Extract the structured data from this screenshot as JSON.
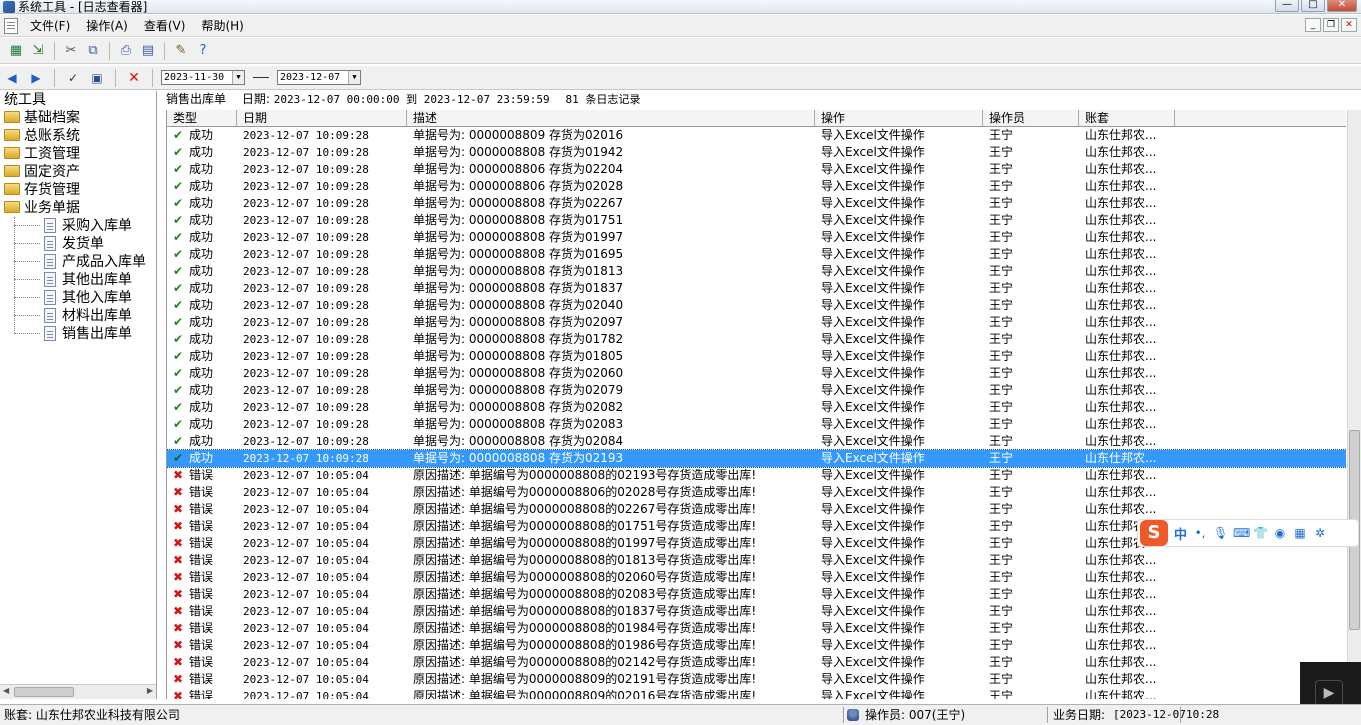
{
  "window": {
    "title": "系统工具 - [日志查看器]"
  },
  "menu": [
    "文件(F)",
    "操作(A)",
    "查看(V)",
    "帮助(H)"
  ],
  "filter": {
    "start_date": "2023-11-30",
    "end_date": "2023-12-07"
  },
  "tree": {
    "root": "统工具",
    "folders": [
      "基础档案",
      "总账系统",
      "工资管理",
      "固定资产",
      "存货管理",
      "业务单据"
    ],
    "children": [
      "采购入库单",
      "发货单",
      "产成品入库单",
      "其他出库单",
      "其他入库单",
      "材料出库单",
      "销售出库单"
    ]
  },
  "summary": {
    "doc_type": "销售出库单",
    "date_label": "日期:",
    "range": "2023-12-07 00:00:00 到 2023-12-07 23:59:59",
    "count": "81 条日志记录"
  },
  "columns": [
    "类型",
    "日期",
    "描述",
    "操作",
    "操作员",
    "账套"
  ],
  "selected_row_index": 19,
  "rows": [
    {
      "type": "成功",
      "status": "ok",
      "date": "2023-12-07 10:09:28",
      "desc": "单据号为:  0000008809 存货为02016",
      "op": "导入Excel文件操作",
      "user": "王宁",
      "acct": "山东仕邦农..."
    },
    {
      "type": "成功",
      "status": "ok",
      "date": "2023-12-07 10:09:28",
      "desc": "单据号为:  0000008808 存货为01942",
      "op": "导入Excel文件操作",
      "user": "王宁",
      "acct": "山东仕邦农..."
    },
    {
      "type": "成功",
      "status": "ok",
      "date": "2023-12-07 10:09:28",
      "desc": "单据号为:  0000008806 存货为02204",
      "op": "导入Excel文件操作",
      "user": "王宁",
      "acct": "山东仕邦农..."
    },
    {
      "type": "成功",
      "status": "ok",
      "date": "2023-12-07 10:09:28",
      "desc": "单据号为:  0000008806 存货为02028",
      "op": "导入Excel文件操作",
      "user": "王宁",
      "acct": "山东仕邦农..."
    },
    {
      "type": "成功",
      "status": "ok",
      "date": "2023-12-07 10:09:28",
      "desc": "单据号为:  0000008808 存货为02267",
      "op": "导入Excel文件操作",
      "user": "王宁",
      "acct": "山东仕邦农..."
    },
    {
      "type": "成功",
      "status": "ok",
      "date": "2023-12-07 10:09:28",
      "desc": "单据号为:  0000008808 存货为01751",
      "op": "导入Excel文件操作",
      "user": "王宁",
      "acct": "山东仕邦农..."
    },
    {
      "type": "成功",
      "status": "ok",
      "date": "2023-12-07 10:09:28",
      "desc": "单据号为:  0000008808 存货为01997",
      "op": "导入Excel文件操作",
      "user": "王宁",
      "acct": "山东仕邦农..."
    },
    {
      "type": "成功",
      "status": "ok",
      "date": "2023-12-07 10:09:28",
      "desc": "单据号为:  0000008808 存货为01695",
      "op": "导入Excel文件操作",
      "user": "王宁",
      "acct": "山东仕邦农..."
    },
    {
      "type": "成功",
      "status": "ok",
      "date": "2023-12-07 10:09:28",
      "desc": "单据号为:  0000008808 存货为01813",
      "op": "导入Excel文件操作",
      "user": "王宁",
      "acct": "山东仕邦农..."
    },
    {
      "type": "成功",
      "status": "ok",
      "date": "2023-12-07 10:09:28",
      "desc": "单据号为:  0000008808 存货为01837",
      "op": "导入Excel文件操作",
      "user": "王宁",
      "acct": "山东仕邦农..."
    },
    {
      "type": "成功",
      "status": "ok",
      "date": "2023-12-07 10:09:28",
      "desc": "单据号为:  0000008808 存货为02040",
      "op": "导入Excel文件操作",
      "user": "王宁",
      "acct": "山东仕邦农..."
    },
    {
      "type": "成功",
      "status": "ok",
      "date": "2023-12-07 10:09:28",
      "desc": "单据号为:  0000008808 存货为02097",
      "op": "导入Excel文件操作",
      "user": "王宁",
      "acct": "山东仕邦农..."
    },
    {
      "type": "成功",
      "status": "ok",
      "date": "2023-12-07 10:09:28",
      "desc": "单据号为:  0000008808 存货为01782",
      "op": "导入Excel文件操作",
      "user": "王宁",
      "acct": "山东仕邦农..."
    },
    {
      "type": "成功",
      "status": "ok",
      "date": "2023-12-07 10:09:28",
      "desc": "单据号为:  0000008808 存货为01805",
      "op": "导入Excel文件操作",
      "user": "王宁",
      "acct": "山东仕邦农..."
    },
    {
      "type": "成功",
      "status": "ok",
      "date": "2023-12-07 10:09:28",
      "desc": "单据号为:  0000008808 存货为02060",
      "op": "导入Excel文件操作",
      "user": "王宁",
      "acct": "山东仕邦农..."
    },
    {
      "type": "成功",
      "status": "ok",
      "date": "2023-12-07 10:09:28",
      "desc": "单据号为:  0000008808 存货为02079",
      "op": "导入Excel文件操作",
      "user": "王宁",
      "acct": "山东仕邦农..."
    },
    {
      "type": "成功",
      "status": "ok",
      "date": "2023-12-07 10:09:28",
      "desc": "单据号为:  0000008808 存货为02082",
      "op": "导入Excel文件操作",
      "user": "王宁",
      "acct": "山东仕邦农..."
    },
    {
      "type": "成功",
      "status": "ok",
      "date": "2023-12-07 10:09:28",
      "desc": "单据号为:  0000008808 存货为02083",
      "op": "导入Excel文件操作",
      "user": "王宁",
      "acct": "山东仕邦农..."
    },
    {
      "type": "成功",
      "status": "ok",
      "date": "2023-12-07 10:09:28",
      "desc": "单据号为:  0000008808 存货为02084",
      "op": "导入Excel文件操作",
      "user": "王宁",
      "acct": "山东仕邦农..."
    },
    {
      "type": "成功",
      "status": "ok",
      "date": "2023-12-07 10:09:28",
      "desc": "单据号为:  0000008808 存货为02193",
      "op": "导入Excel文件操作",
      "user": "王宁",
      "acct": "山东仕邦农..."
    },
    {
      "type": "错误",
      "status": "err",
      "date": "2023-12-07 10:05:04",
      "desc": "原因描述: 单据编号为0000008808的02193号存货造成零出库!",
      "op": "导入Excel文件操作",
      "user": "王宁",
      "acct": "山东仕邦农..."
    },
    {
      "type": "错误",
      "status": "err",
      "date": "2023-12-07 10:05:04",
      "desc": "原因描述: 单据编号为0000008806的02028号存货造成零出库!",
      "op": "导入Excel文件操作",
      "user": "王宁",
      "acct": "山东仕邦农..."
    },
    {
      "type": "错误",
      "status": "err",
      "date": "2023-12-07 10:05:04",
      "desc": "原因描述: 单据编号为0000008808的02267号存货造成零出库!",
      "op": "导入Excel文件操作",
      "user": "王宁",
      "acct": "山东仕邦农..."
    },
    {
      "type": "错误",
      "status": "err",
      "date": "2023-12-07 10:05:04",
      "desc": "原因描述: 单据编号为0000008808的01751号存货造成零出库!",
      "op": "导入Excel文件操作",
      "user": "王宁",
      "acct": "山东仕邦农..."
    },
    {
      "type": "错误",
      "status": "err",
      "date": "2023-12-07 10:05:04",
      "desc": "原因描述: 单据编号为0000008808的01997号存货造成零出库!",
      "op": "导入Excel文件操作",
      "user": "王宁",
      "acct": "山东仕邦农..."
    },
    {
      "type": "错误",
      "status": "err",
      "date": "2023-12-07 10:05:04",
      "desc": "原因描述: 单据编号为0000008808的01813号存货造成零出库!",
      "op": "导入Excel文件操作",
      "user": "王宁",
      "acct": "山东仕邦农..."
    },
    {
      "type": "错误",
      "status": "err",
      "date": "2023-12-07 10:05:04",
      "desc": "原因描述: 单据编号为0000008808的02060号存货造成零出库!",
      "op": "导入Excel文件操作",
      "user": "王宁",
      "acct": "山东仕邦农..."
    },
    {
      "type": "错误",
      "status": "err",
      "date": "2023-12-07 10:05:04",
      "desc": "原因描述: 单据编号为0000008808的02083号存货造成零出库!",
      "op": "导入Excel文件操作",
      "user": "王宁",
      "acct": "山东仕邦农..."
    },
    {
      "type": "错误",
      "status": "err",
      "date": "2023-12-07 10:05:04",
      "desc": "原因描述: 单据编号为0000008808的01837号存货造成零出库!",
      "op": "导入Excel文件操作",
      "user": "王宁",
      "acct": "山东仕邦农..."
    },
    {
      "type": "错误",
      "status": "err",
      "date": "2023-12-07 10:05:04",
      "desc": "原因描述: 单据编号为0000008808的01984号存货造成零出库!",
      "op": "导入Excel文件操作",
      "user": "王宁",
      "acct": "山东仕邦农..."
    },
    {
      "type": "错误",
      "status": "err",
      "date": "2023-12-07 10:05:04",
      "desc": "原因描述: 单据编号为0000008808的01986号存货造成零出库!",
      "op": "导入Excel文件操作",
      "user": "王宁",
      "acct": "山东仕邦农..."
    },
    {
      "type": "错误",
      "status": "err",
      "date": "2023-12-07 10:05:04",
      "desc": "原因描述: 单据编号为0000008808的02142号存货造成零出库!",
      "op": "导入Excel文件操作",
      "user": "王宁",
      "acct": "山东仕邦农..."
    },
    {
      "type": "错误",
      "status": "err",
      "date": "2023-12-07 10:05:04",
      "desc": "原因描述: 单据编号为0000008809的02191号存货造成零出库!",
      "op": "导入Excel文件操作",
      "user": "王宁",
      "acct": "山东仕邦农..."
    },
    {
      "type": "错误",
      "status": "err",
      "date": "2023-12-07 10:05:04",
      "desc": "原因描述: 单据编号为0000008809的02016号存货造成零出库!",
      "op": "导入Excel文件操作",
      "user": "王宁",
      "acct": "山东仕邦农..."
    }
  ],
  "statusbar": {
    "account": "账套: 山东仕邦农业科技有限公司",
    "operator": "操作员: 007(王宁)",
    "biz_date_label": "业务日期:",
    "biz_date": "[2023-12-07",
    "time": "10:28"
  },
  "ime": {
    "logo": "S",
    "mode": "中"
  },
  "colors": {
    "selection": "#3399ff",
    "ok_icon": "#1a8a1a",
    "err_icon": "#d41717"
  },
  "icons": {
    "ok": "check-icon",
    "err": "cross-icon",
    "folder": "folder-icon",
    "file": "file-icon"
  }
}
